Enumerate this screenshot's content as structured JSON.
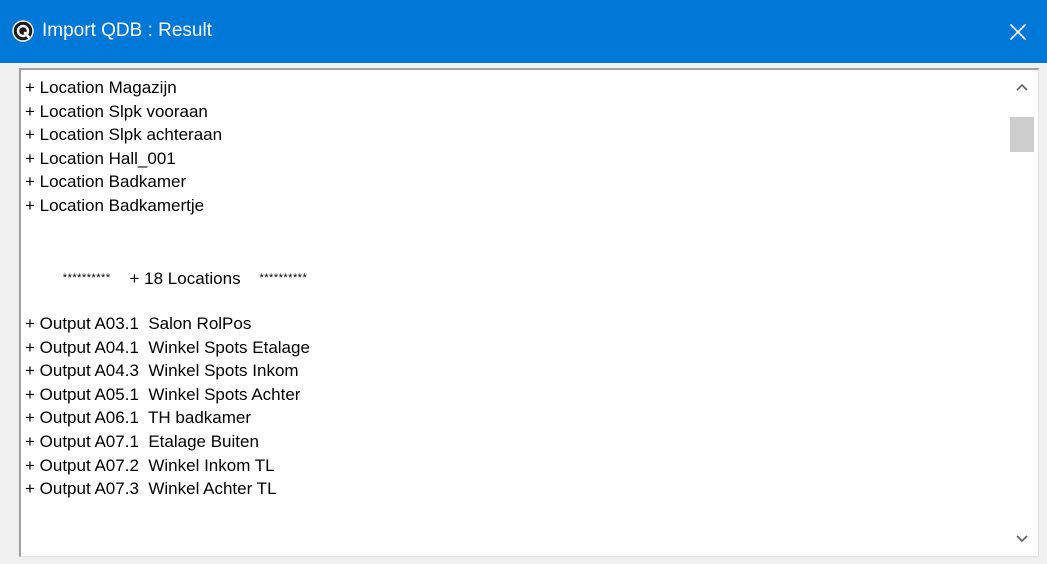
{
  "window": {
    "title": "Import QDB : Result",
    "accent_color": "#0078d7",
    "icon": "app-icon",
    "close_icon": "close-icon"
  },
  "result_text": {
    "lines": [
      "+ Location Magazijn",
      "+ Location Slpk vooraan",
      "+ Location Slpk achteraan",
      "+ Location Hall_001",
      "+ Location Badkamer",
      "+ Location Badkamertje",
      "",
      "",
      "",
      "",
      "+ Output A03.1  Salon RolPos",
      "+ Output A04.1  Winkel Spots Etalage",
      "+ Output A04.3  Winkel Spots Inkom",
      "+ Output A05.1  Winkel Spots Achter",
      "+ Output A06.1  TH badkamer",
      "+ Output A07.1  Etalage Buiten",
      "+ Output A07.2  Winkel Inkom TL",
      "+ Output A07.3  Winkel Achter TL"
    ],
    "summary": {
      "stars_left": "**********",
      "text": "+ 18 Locations",
      "stars_right": "**********"
    }
  },
  "scrollbar": {
    "up_icon": "chevron-up-icon",
    "down_icon": "chevron-down-icon"
  }
}
